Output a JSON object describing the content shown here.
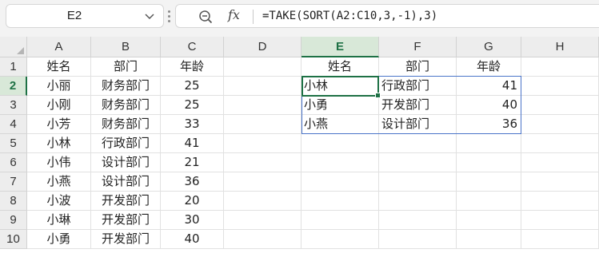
{
  "name_box": {
    "value": "E2"
  },
  "formula_bar": {
    "fx_label": "fx",
    "formula": "=TAKE(SORT(A2:C10,3,-1),3)"
  },
  "columns": [
    "A",
    "B",
    "C",
    "D",
    "E",
    "F",
    "G",
    "H"
  ],
  "selected_column": "E",
  "rows": [
    "1",
    "2",
    "3",
    "4",
    "5",
    "6",
    "7",
    "8",
    "9",
    "10"
  ],
  "selected_row": "2",
  "source_table": {
    "headers": [
      "姓名",
      "部门",
      "年龄"
    ],
    "rows": [
      [
        "小丽",
        "财务部门",
        "25"
      ],
      [
        "小刚",
        "财务部门",
        "25"
      ],
      [
        "小芳",
        "财务部门",
        "33"
      ],
      [
        "小林",
        "行政部门",
        "41"
      ],
      [
        "小伟",
        "设计部门",
        "21"
      ],
      [
        "小燕",
        "设计部门",
        "36"
      ],
      [
        "小波",
        "开发部门",
        "20"
      ],
      [
        "小琳",
        "开发部门",
        "30"
      ],
      [
        "小勇",
        "开发部门",
        "40"
      ]
    ]
  },
  "result_table": {
    "headers": [
      "姓名",
      "部门",
      "年龄"
    ],
    "rows": [
      [
        "小林",
        "行政部门",
        "41"
      ],
      [
        "小勇",
        "开发部门",
        "40"
      ],
      [
        "小燕",
        "设计部门",
        "36"
      ]
    ]
  },
  "colors": {
    "selection": "#1e7145",
    "spill_border": "#4a74c9",
    "header_bg": "#ededed"
  }
}
